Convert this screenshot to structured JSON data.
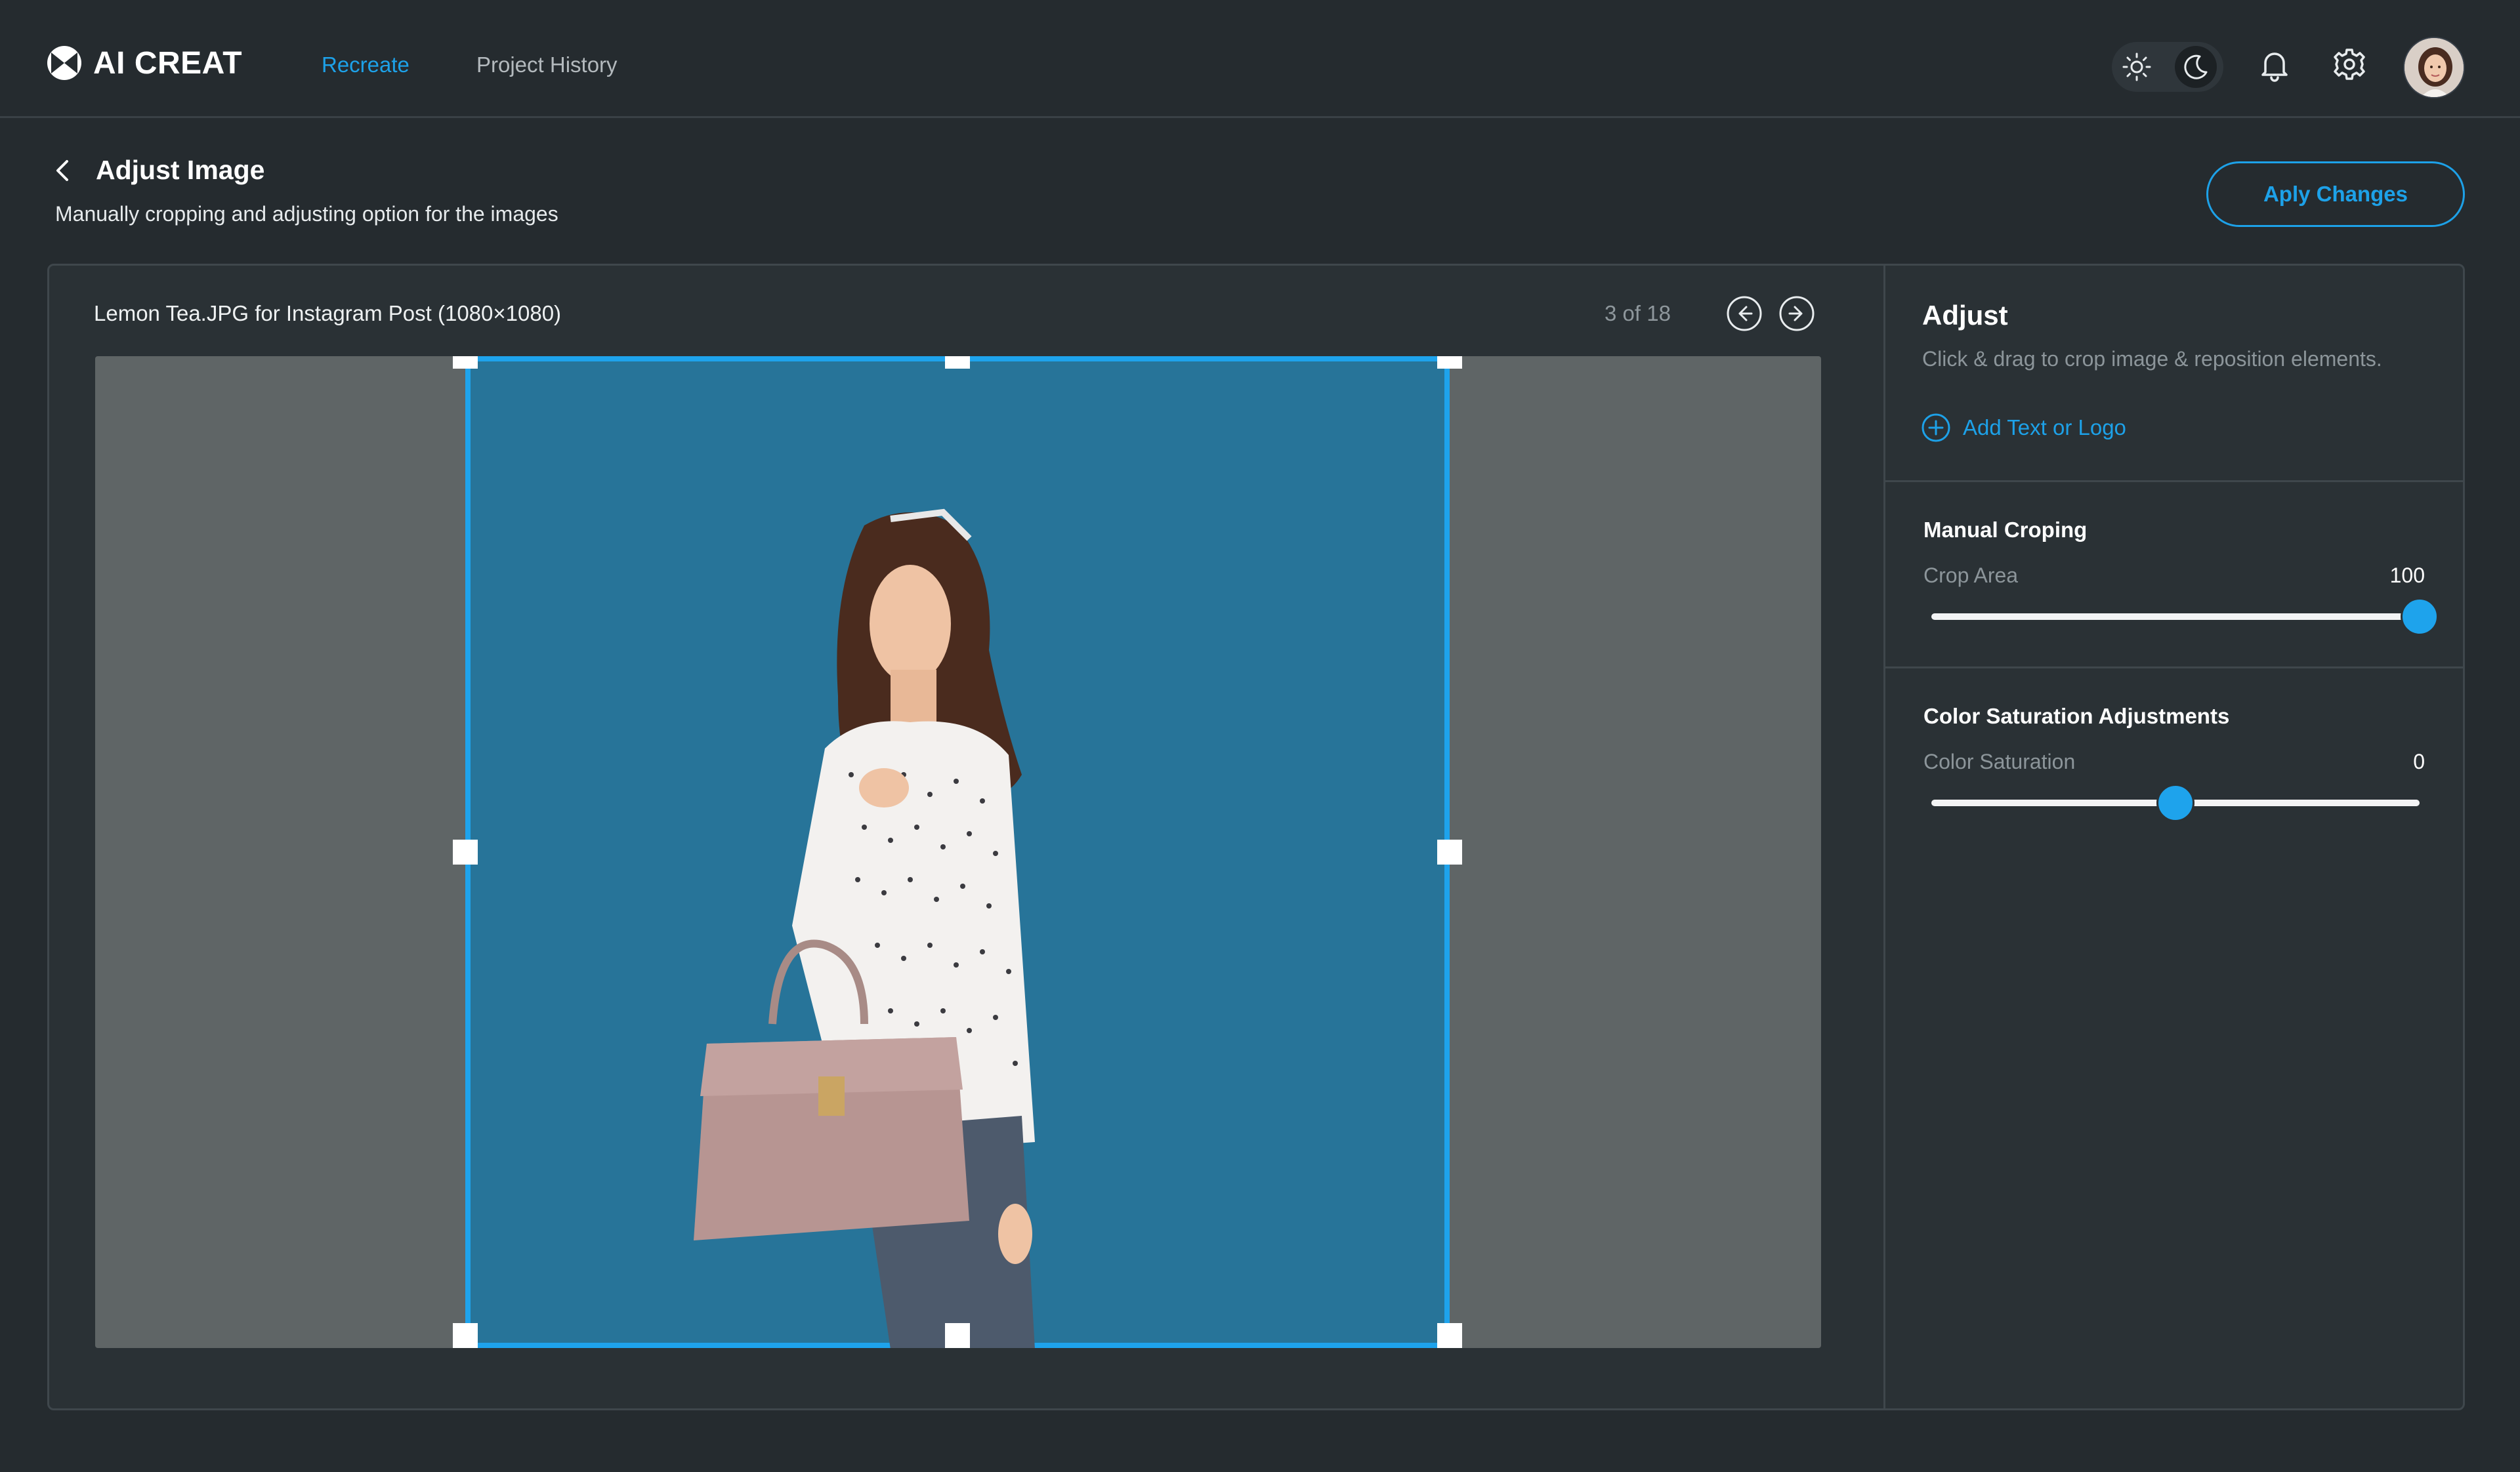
{
  "app": {
    "name": "AI CREAT",
    "nav": [
      {
        "label": "Recreate",
        "active": true
      },
      {
        "label": "Project History",
        "active": false
      }
    ],
    "theme_options": [
      "light-mode-icon",
      "dark-mode-icon"
    ],
    "selected_theme": "dark"
  },
  "page": {
    "title": "Adjust Image",
    "subtitle": "Manually cropping and adjusting option for the images",
    "apply_label": "Aply Changes"
  },
  "editor": {
    "file_label": "Lemon Tea.JPG for Instagram Post (1080×1080)",
    "page_count": "3 of 18"
  },
  "panel": {
    "adjust_title": "Adjust",
    "adjust_desc": "Click & drag to crop image & reposition elements.",
    "add_text_label": "Add Text or Logo",
    "crop": {
      "title": "Manual Croping",
      "label": "Crop Area",
      "value": "100",
      "fraction": 1.0
    },
    "saturation": {
      "title": "Color Saturation Adjustments",
      "label": "Color Saturation",
      "value": "0",
      "fraction": 0.5
    }
  },
  "colors": {
    "accent": "#1da1e8",
    "background": "#252b2f",
    "crop_fill": "#277499"
  }
}
